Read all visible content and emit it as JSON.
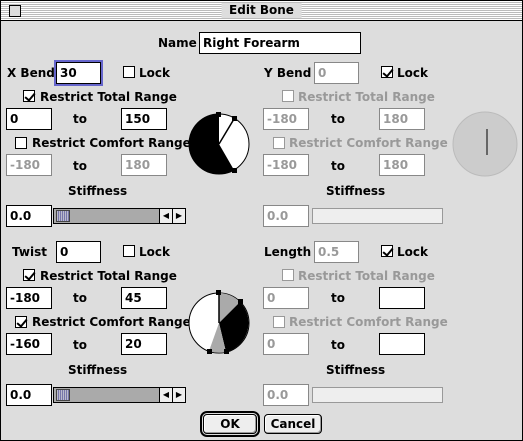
{
  "window": {
    "title": "Edit Bone"
  },
  "name": {
    "label": "Name",
    "value": "Right Forearm"
  },
  "x_bend": {
    "label": "X Bend",
    "value": "30",
    "lock_label": "Lock",
    "lock_checked": false,
    "restrict_total_label": "Restrict Total Range",
    "restrict_total_checked": true,
    "total_from": "0",
    "total_to": "150",
    "to_label": "to",
    "restrict_comfort_label": "Restrict Comfort Range",
    "restrict_comfort_checked": false,
    "comfort_from": "-180",
    "comfort_to": "180",
    "stiffness_label": "Stiffness",
    "stiffness_value": "0.0"
  },
  "y_bend": {
    "label": "Y Bend",
    "value": "0",
    "lock_label": "Lock",
    "lock_checked": true,
    "restrict_total_label": "Restrict Total Range",
    "restrict_total_checked": false,
    "total_from": "-180",
    "total_to": "180",
    "to_label": "to",
    "restrict_comfort_label": "Restrict Comfort Range",
    "restrict_comfort_checked": false,
    "comfort_from": "-180",
    "comfort_to": "180",
    "stiffness_label": "Stiffness",
    "stiffness_value": "0.0"
  },
  "twist": {
    "label": "Twist",
    "value": "0",
    "lock_label": "Lock",
    "lock_checked": false,
    "restrict_total_label": "Restrict Total Range",
    "restrict_total_checked": true,
    "total_from": "-180",
    "total_to": "45",
    "to_label": "to",
    "restrict_comfort_label": "Restrict Comfort Range",
    "restrict_comfort_checked": true,
    "comfort_from": "-160",
    "comfort_to": "20",
    "stiffness_label": "Stiffness",
    "stiffness_value": "0.0"
  },
  "length": {
    "label": "Length",
    "value": "0.5",
    "lock_label": "Lock",
    "lock_checked": true,
    "restrict_total_label": "Restrict Total Range",
    "restrict_total_checked": false,
    "total_from": "0",
    "total_to": "",
    "to_label": "to",
    "restrict_comfort_label": "Restrict Comfort Range",
    "restrict_comfort_checked": false,
    "comfort_from": "0",
    "comfort_to": "",
    "stiffness_label": "Stiffness",
    "stiffness_value": "0.0"
  },
  "buttons": {
    "ok": "OK",
    "cancel": "Cancel"
  },
  "icons": {
    "left_arrow": "◀",
    "right_arrow": "▶"
  }
}
